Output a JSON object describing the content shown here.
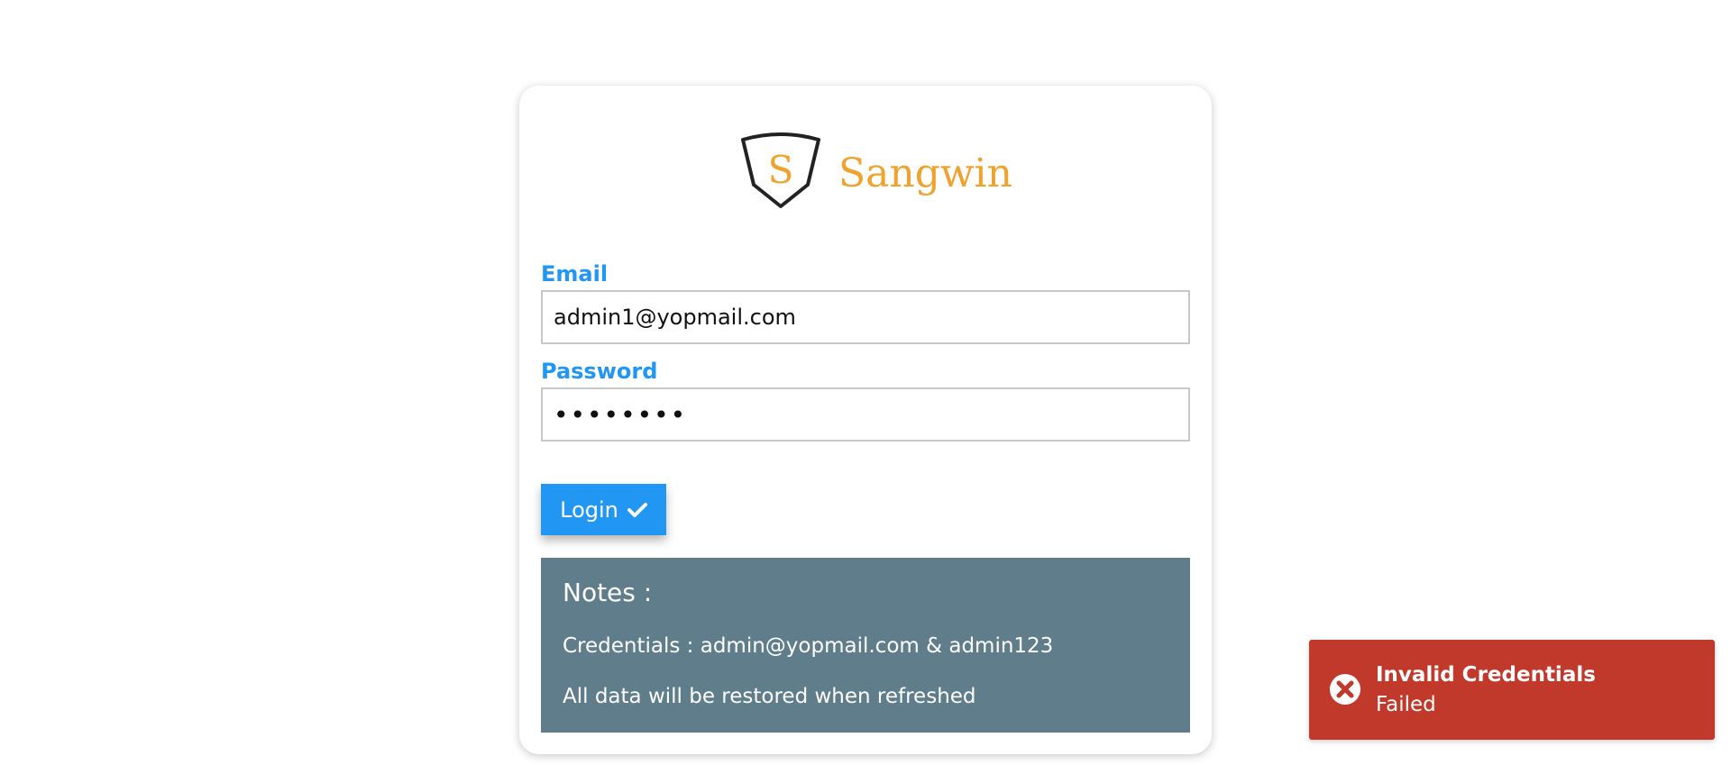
{
  "brand": {
    "logo_letter": "S",
    "name": "Sangwin",
    "accent_color": "#f0a22e"
  },
  "form": {
    "email_label": "Email",
    "email_value": "admin1@yopmail.com",
    "password_label": "Password",
    "password_value": "admin123",
    "login_label": "Login",
    "login_icon": "check-icon",
    "accent_color": "#2196f3"
  },
  "notes": {
    "title": "Notes :",
    "lines": [
      "Credentials : admin@yopmail.com & admin123",
      "All data will be restored when refreshed"
    ],
    "background": "#607d8b"
  },
  "toast": {
    "icon": "error-circle-icon",
    "title": "Invalid Credentials",
    "detail": "Failed",
    "background": "#c0392b"
  }
}
